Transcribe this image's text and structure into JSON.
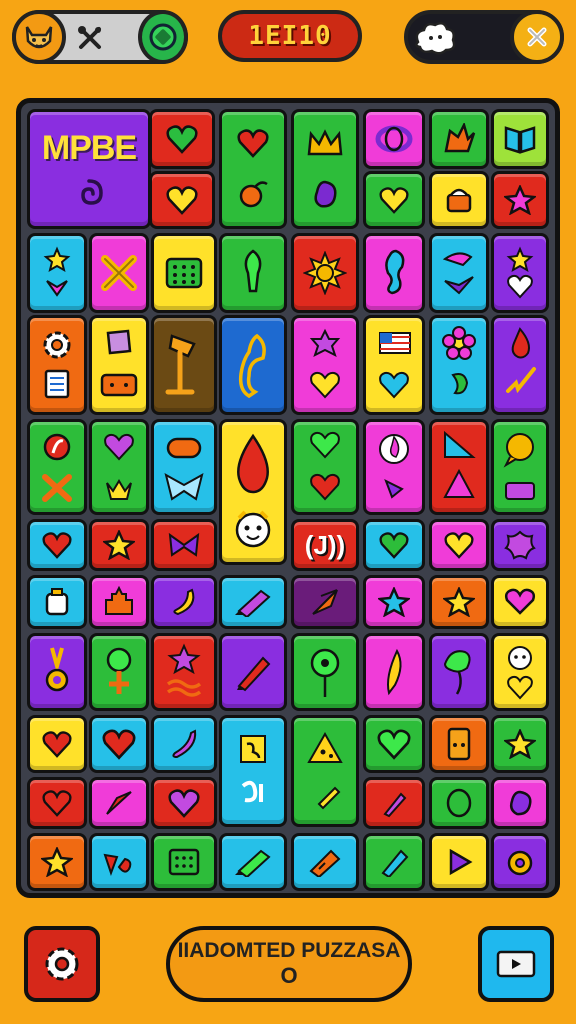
{
  "header": {
    "score": "1EI10",
    "avatar_icon": "cat-face-icon",
    "tool_icon": "crossed-tools-icon",
    "badge_icon": "green-gem-icon",
    "pet_icon": "ghost-cloud-icon",
    "close_icon": "close-icon"
  },
  "board": {
    "title_tile_text": "MPBE",
    "title_tile_icon": "swirl-icon",
    "center_tile_text": "(J))",
    "tiles": [
      {
        "color": "#e02a1e",
        "icon": "heart",
        "icon_color": "#2bbd3f"
      },
      {
        "color": "#2dbd3a",
        "icon": "heart",
        "icon_color": "#e02a1e"
      },
      {
        "color": "#2dbd3a",
        "icon": "crown",
        "icon_color": "#f5b800"
      },
      {
        "color": "#f03cd8",
        "icon": "ring",
        "icon_color": "#7b2ad0"
      },
      {
        "color": "#2dbd3a",
        "icon": "leaf",
        "icon_color": "#f06a12"
      },
      {
        "color": "#2dbd3a",
        "icon": "book",
        "icon_color": "#26c0e8"
      },
      {
        "color": "#e02a1e",
        "icon": "heart",
        "icon_color": "#ffe12a"
      },
      {
        "color": "#2dbd3a",
        "icon": "fruit",
        "icon_color": "#f06a12"
      },
      {
        "color": "#2dbd3a",
        "icon": "blob",
        "icon_color": "#7b2ad0"
      },
      {
        "color": "#2dbd3a",
        "icon": "heart",
        "icon_color": "#ffe12a"
      },
      {
        "color": "#ffe12a",
        "icon": "pot",
        "icon_color": "#f06a12"
      },
      {
        "color": "#e02a1e",
        "icon": "star",
        "icon_color": "#f03cd8"
      }
    ]
  },
  "colors": {
    "background": "#f7a514",
    "board": "#3c3f4a",
    "red": "#e02a1e",
    "green": "#2dbd3a",
    "yellow": "#ffe12a",
    "cyan": "#26c0e8",
    "magenta": "#f03cd8",
    "purple": "#7b2ad0",
    "orange": "#f39a13"
  },
  "footer": {
    "name_label": "IIADOMTED PUZZASA",
    "name_value": "O",
    "settings_icon": "gear-icon",
    "play_icon": "play-icon"
  }
}
